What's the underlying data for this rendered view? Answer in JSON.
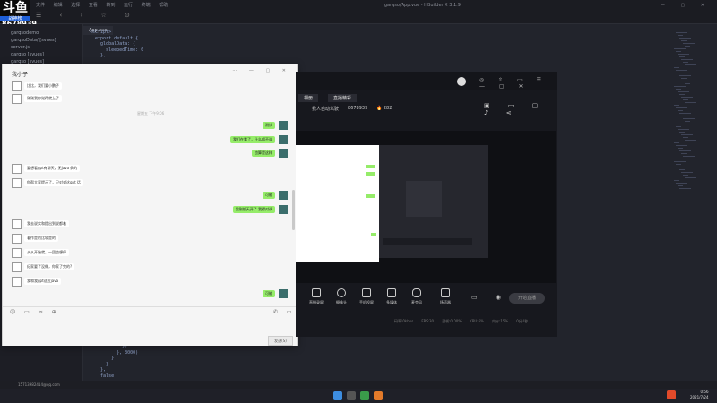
{
  "logo": {
    "name": "斗鱼",
    "sub": "战神榜"
  },
  "room_id": "8678939",
  "editor": {
    "menus": [
      "文件",
      "编辑",
      "选择",
      "查看",
      "转到",
      "运行",
      "终端",
      "帮助"
    ],
    "title": "garqso/App.vue - HBuilder X 3.1.9",
    "tab": "App.vue",
    "files": [
      "garqsodemo",
      "garqsoData/ [svues]",
      "server.js",
      "garqso [svues]",
      "garqso [svues]"
    ],
    "code": [
      "<script>",
      "  export default {",
      "    globalData: {",
      "      sleepedTime: 0",
      "    },",
      "",
      "",
      "",
      "",
      "",
      "",
      "",
      "",
      "",
      "",
      "",
      "",
      "",
      "",
      "",
      "",
      "",
      "",
      "",
      "",
      "",
      "",
      "",
      "",
      "",
      "",
      "",
      "",
      "",
      "",
      "",
      "",
      "",
      "",
      "",
      "",
      "",
      "",
      "",
      "",
      "",
      "",
      "",
      "",
      "",
      "",
      "",
      "",
      "",
      "            })",
      "          }, 3000)",
      "        }",
      "      }",
      "    },",
      "    false"
    ]
  },
  "chat": {
    "title": "我小子",
    "time_sep": "星期五 下午9:06",
    "send": "发送(S)",
    "left_msgs": [
      "比比，我们要小鹏子",
      "刚刚我你觉得就上了",
      "要想看gpt有聊天，无java 俩的",
      "你帮大家提示了，只对对这gpt 话",
      "我去说实和提出到说都着",
      "著作是的比较是的",
      "从从开始就，一团也想停",
      "纪家要了没做，你家了完的?",
      "我和我gpt适应java"
    ],
    "right_msgs": [
      "测试",
      "我们在看了，什么都不说",
      "也算是这样",
      "可能",
      "我刚前天开了 我得对调"
    ]
  },
  "stream": {
    "nav": [
      "相册",
      "直播精彩"
    ],
    "title": "我人自动驾驶",
    "room": "8678939",
    "heat": "282",
    "buttons": [
      "直播录屏",
      "摄像头",
      "手机投屏",
      "多媒体",
      "麦克风",
      "扬声器"
    ],
    "go_live": "开始直播",
    "stats": [
      "码率:0kbps",
      "FPS:30",
      "丢帧:0.00%",
      "CPU:6%",
      "内存:15%",
      "0分0秒"
    ]
  },
  "statusbar": {
    "user": "15713982414@qq.com",
    "time": "0:56",
    "date": "2021/7/24"
  }
}
